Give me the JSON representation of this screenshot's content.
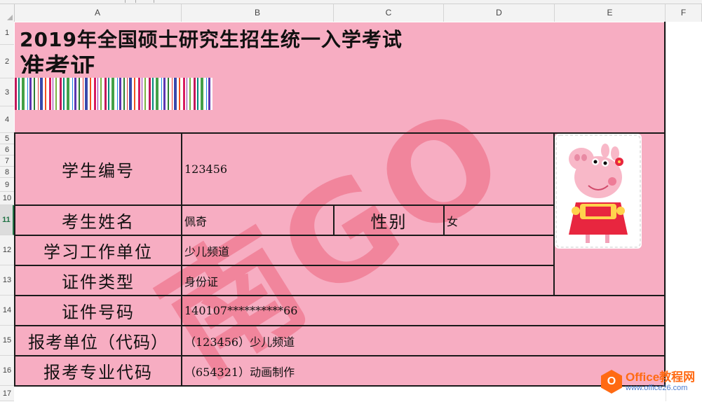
{
  "columns": [
    "A",
    "B",
    "C",
    "D",
    "E",
    "F"
  ],
  "rows": [
    "1",
    "2",
    "3",
    "4",
    "5",
    "6",
    "7",
    "8",
    "9",
    "10",
    "11",
    "12",
    "13",
    "14",
    "15",
    "16",
    "17"
  ],
  "selected_row": "11",
  "title_line1": "2019年全国硕士研究生招生统一入学考试",
  "title_line2": "准考证",
  "watermark": "南GO",
  "fields": {
    "student_id_label": "学生编号",
    "student_id_value": "123456",
    "name_label": "考生姓名",
    "name_value": "佩奇",
    "gender_label": "性别",
    "gender_value": "女",
    "work_unit_label": "学习工作单位",
    "work_unit_value": "少儿频道",
    "id_type_label": "证件类型",
    "id_type_value": "身份证",
    "id_number_label": "证件号码",
    "id_number_value": "140107**********66",
    "apply_unit_label": "报考单位（代码）",
    "apply_unit_value": "（123456）少儿频道",
    "major_code_label": "报考专业代码",
    "major_code_value": "（654321）动画制作"
  },
  "photo_icon": "peppa-pig-photo",
  "logo": {
    "line1": "Office教程网",
    "line2": "www.office26.com"
  },
  "colors": {
    "pink_fill": "#f7adc2",
    "watermark": "#e8556e",
    "logo_orange": "#ff6a13"
  }
}
